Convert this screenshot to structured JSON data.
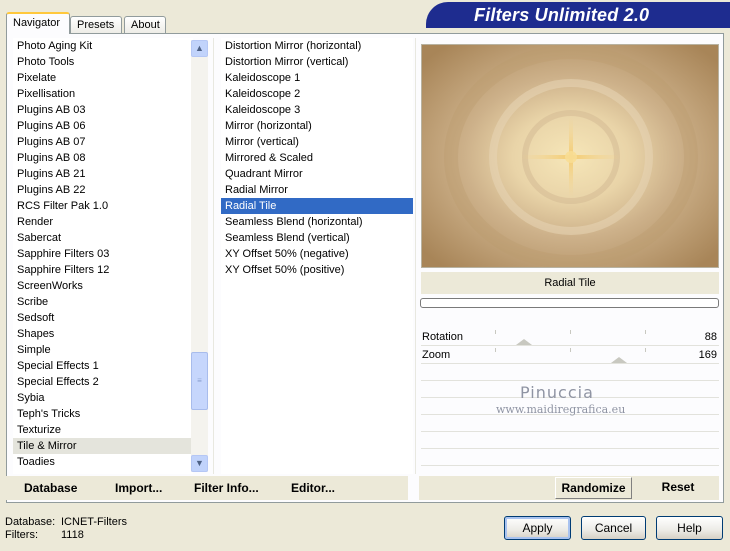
{
  "tabs": [
    {
      "label": "Navigator"
    },
    {
      "label": "Presets"
    },
    {
      "label": "About"
    }
  ],
  "app_title": "Filters Unlimited 2.0",
  "categories": [
    "Photo Aging Kit",
    "Photo Tools",
    "Pixelate",
    "Pixellisation",
    "Plugins AB 03",
    "Plugins AB 06",
    "Plugins AB 07",
    "Plugins AB 08",
    "Plugins AB 21",
    "Plugins AB 22",
    "RCS Filter Pak 1.0",
    "Render",
    "Sabercat",
    "Sapphire Filters 03",
    "Sapphire Filters 12",
    "ScreenWorks",
    "Scribe",
    "Sedsoft",
    "Shapes",
    "Simple",
    "Special Effects 1",
    "Special Effects 2",
    "Sybia",
    "Teph's Tricks",
    "Texturize",
    "Tile & Mirror",
    "Toadies"
  ],
  "selected_category": "Tile & Mirror",
  "filters": [
    "Distortion Mirror (horizontal)",
    "Distortion Mirror (vertical)",
    "Kaleidoscope 1",
    "Kaleidoscope 2",
    "Kaleidoscope 3",
    "Mirror (horizontal)",
    "Mirror (vertical)",
    "Mirrored & Scaled",
    "Quadrant Mirror",
    "Radial Mirror",
    "Radial Tile",
    "Seamless Blend (horizontal)",
    "Seamless Blend (vertical)",
    "XY Offset 50% (negative)",
    "XY Offset 50% (positive)"
  ],
  "selected_filter": "Radial Tile",
  "preview": {
    "filter_name": "Radial Tile",
    "progress_percent": 0
  },
  "params": [
    {
      "label": "Rotation",
      "value": "88",
      "slider_fraction": 0.345
    },
    {
      "label": "Zoom",
      "value": "169",
      "slider_fraction": 0.663
    }
  ],
  "watermark": {
    "line1": "Pinuccia",
    "line2": "www.maidiregrafica.eu"
  },
  "panel_buttons": {
    "database": "Database",
    "import": "Import...",
    "filter_info": "Filter Info...",
    "editor": "Editor...",
    "randomize": "Randomize",
    "reset": "Reset"
  },
  "footer": {
    "database_label": "Database:",
    "database_value": "ICNET-Filters",
    "filters_label": "Filters:",
    "filters_value": "1118"
  },
  "dialog_buttons": {
    "apply": "Apply",
    "cancel": "Cancel",
    "help": "Help"
  },
  "colors": {
    "banner": "#1e2c8f",
    "selection": "#316ac5",
    "highlight": "#e4e4dc"
  }
}
